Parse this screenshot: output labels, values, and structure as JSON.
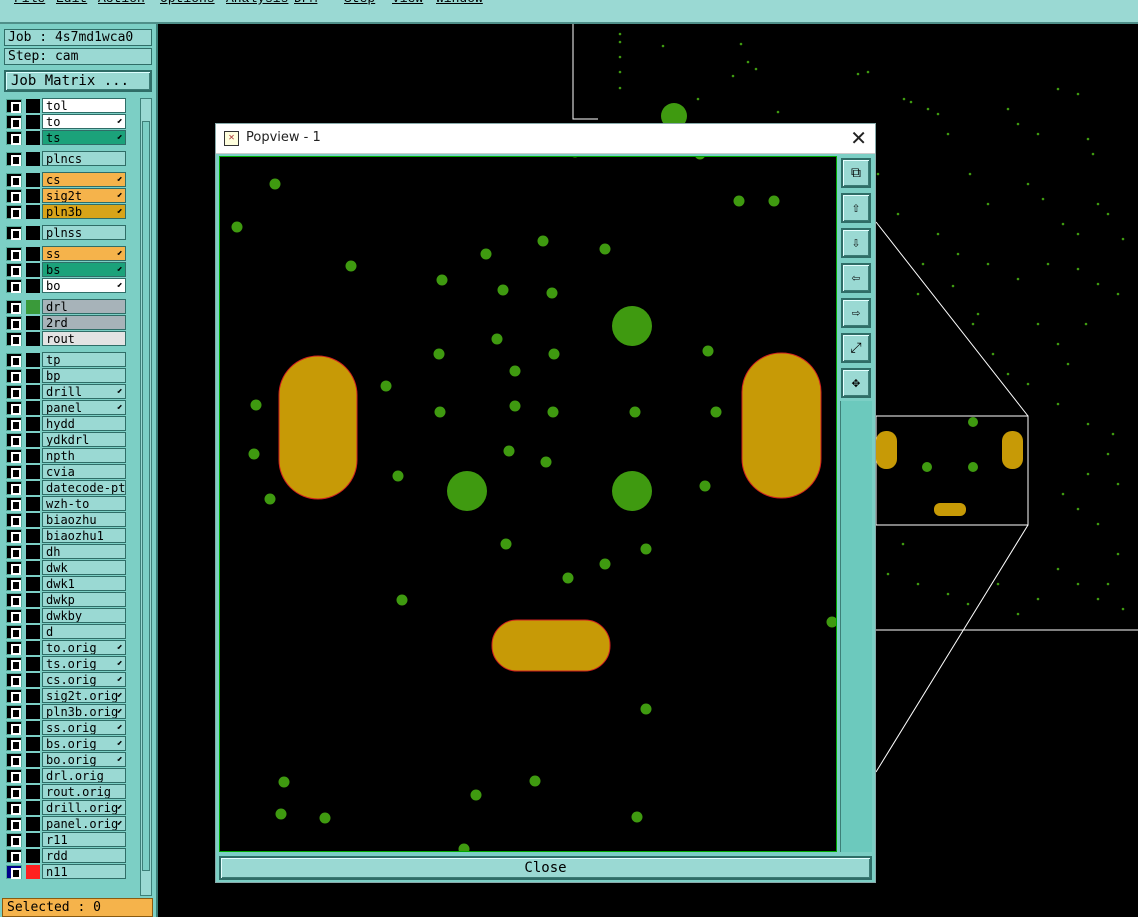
{
  "menubar": {
    "items": [
      "File",
      "Edit",
      "Action",
      "Options",
      "Analysis",
      "DFM",
      "Step",
      "View",
      "Window"
    ]
  },
  "job": {
    "label": "Job : 4s7md1wca0"
  },
  "step": {
    "label": "Step: cam"
  },
  "job_matrix_button": "Job Matrix ...",
  "layers": [
    {
      "name": "tol",
      "bg": "#ffffff",
      "pin": false
    },
    {
      "name": "to",
      "bg": "#ffffff",
      "pin": true
    },
    {
      "name": "ts",
      "bg": "#1ba27a",
      "pin": true
    },
    {
      "name": "plncs",
      "bg": "#9ad9d3",
      "pin": false
    },
    {
      "name": "cs",
      "bg": "#f5b34b",
      "pin": true
    },
    {
      "name": "sig2t",
      "bg": "#f5b34b",
      "pin": true
    },
    {
      "name": "pln3b",
      "bg": "#d8a419",
      "pin": true
    },
    {
      "name": "plnss",
      "bg": "#9ad9d3",
      "pin": false
    },
    {
      "name": "ss",
      "bg": "#f5b34b",
      "pin": true
    },
    {
      "name": "bs",
      "bg": "#1ba27a",
      "pin": true
    },
    {
      "name": "bo",
      "bg": "#ffffff",
      "pin": true
    },
    {
      "name": "drl",
      "bg": "#a7b3b9",
      "pin": false,
      "swatch": "#3a9a3a"
    },
    {
      "name": "2rd",
      "bg": "#a7b3b9",
      "pin": false
    },
    {
      "name": "rout",
      "bg": "#e3e3e3",
      "pin": false
    },
    {
      "name": "tp",
      "bg": "#9ad9d3",
      "pin": false
    },
    {
      "name": "bp",
      "bg": "#9ad9d3",
      "pin": false
    },
    {
      "name": "drill",
      "bg": "#9ad9d3",
      "pin": true
    },
    {
      "name": "panel",
      "bg": "#9ad9d3",
      "pin": true
    },
    {
      "name": "hydd",
      "bg": "#9ad9d3",
      "pin": false
    },
    {
      "name": "ydkdrl",
      "bg": "#9ad9d3",
      "pin": false
    },
    {
      "name": "npth",
      "bg": "#9ad9d3",
      "pin": false
    },
    {
      "name": "cvia",
      "bg": "#9ad9d3",
      "pin": false
    },
    {
      "name": "datecode-pt",
      "bg": "#9ad9d3",
      "pin": false
    },
    {
      "name": "wzh-to",
      "bg": "#9ad9d3",
      "pin": false
    },
    {
      "name": "biaozhu",
      "bg": "#9ad9d3",
      "pin": false
    },
    {
      "name": "biaozhu1",
      "bg": "#9ad9d3",
      "pin": false
    },
    {
      "name": "dh",
      "bg": "#9ad9d3",
      "pin": false
    },
    {
      "name": "dwk",
      "bg": "#9ad9d3",
      "pin": false
    },
    {
      "name": "dwk1",
      "bg": "#9ad9d3",
      "pin": false
    },
    {
      "name": "dwkp",
      "bg": "#9ad9d3",
      "pin": false
    },
    {
      "name": "dwkby",
      "bg": "#9ad9d3",
      "pin": false
    },
    {
      "name": "d",
      "bg": "#9ad9d3",
      "pin": false
    },
    {
      "name": "to.orig",
      "bg": "#9ad9d3",
      "pin": true
    },
    {
      "name": "ts.orig",
      "bg": "#9ad9d3",
      "pin": true
    },
    {
      "name": "cs.orig",
      "bg": "#9ad9d3",
      "pin": true
    },
    {
      "name": "sig2t.orig",
      "bg": "#9ad9d3",
      "pin": true
    },
    {
      "name": "pln3b.orig",
      "bg": "#9ad9d3",
      "pin": true
    },
    {
      "name": "ss.orig",
      "bg": "#9ad9d3",
      "pin": true
    },
    {
      "name": "bs.orig",
      "bg": "#9ad9d3",
      "pin": true
    },
    {
      "name": "bo.orig",
      "bg": "#9ad9d3",
      "pin": true
    },
    {
      "name": "drl.orig",
      "bg": "#9ad9d3",
      "pin": false
    },
    {
      "name": "rout.orig",
      "bg": "#9ad9d3",
      "pin": false
    },
    {
      "name": "drill.orig",
      "bg": "#9ad9d3",
      "pin": true
    },
    {
      "name": "panel.orig",
      "bg": "#9ad9d3",
      "pin": true
    },
    {
      "name": "r11",
      "bg": "#9ad9d3",
      "pin": false
    },
    {
      "name": "rdd",
      "bg": "#9ad9d3",
      "pin": false
    },
    {
      "name": "n11",
      "bg": "#9ad9d3",
      "pin": false,
      "swatch": "#ff2020",
      "special": true
    }
  ],
  "selected": {
    "label": "Selected : 0"
  },
  "popview": {
    "title": "Popview - 1",
    "close_label": "Close",
    "toolbar_icons": [
      "copy-view-icon",
      "pan-up-icon",
      "pan-down-icon",
      "pan-left-icon",
      "pan-right-icon",
      "zoom-fit-icon",
      "zoom-home-icon"
    ]
  },
  "colors": {
    "pad_green": "#3f9a10",
    "pad_gold": "#c79a06",
    "outline": "#ffffff"
  }
}
